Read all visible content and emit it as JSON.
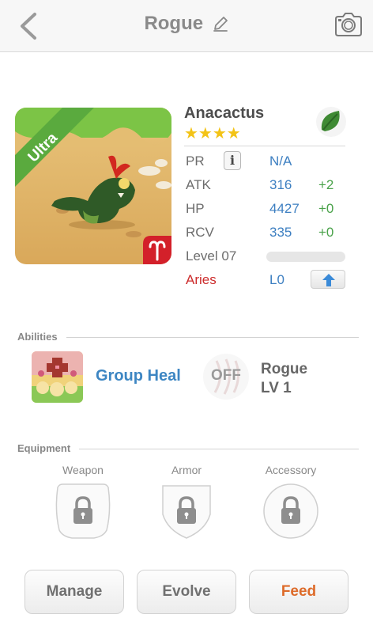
{
  "header": {
    "title": "Rogue",
    "icons": {
      "back": "chevron-left-icon",
      "edit": "pencil-icon",
      "camera": "camera-icon"
    }
  },
  "monster": {
    "rarity_ribbon": "Ultra",
    "name": "Anacactus",
    "star_count": 4,
    "stars": "★★★★",
    "element_icon": "leaf-icon",
    "zodiac_icon": "aries-icon",
    "stats": {
      "pr": {
        "label": "PR",
        "value": "N/A"
      },
      "atk": {
        "label": "ATK",
        "value": "316",
        "bonus": "+2"
      },
      "hp": {
        "label": "HP",
        "value": "4427",
        "bonus": "+0"
      },
      "rcv": {
        "label": "RCV",
        "value": "335",
        "bonus": "+0"
      },
      "level": {
        "label": "Level 07",
        "xp_fraction": 0.0
      },
      "sign": {
        "label": "Aries",
        "value": "L0"
      }
    },
    "colors": {
      "accent_blue": "#3d7fc1",
      "bonus_green": "#4aa24a",
      "aries_red": "#cc2c2c",
      "star_yellow": "#f3c316"
    }
  },
  "abilities": {
    "section_label": "Abilities",
    "primary": {
      "name": "Group Heal"
    },
    "role": {
      "status": "OFF",
      "name": "Rogue",
      "level": "LV 1"
    }
  },
  "equipment": {
    "section_label": "Equipment",
    "slots": [
      {
        "label": "Weapon",
        "state": "locked"
      },
      {
        "label": "Armor",
        "state": "locked"
      },
      {
        "label": "Accessory",
        "state": "locked"
      }
    ]
  },
  "actions": {
    "manage": "Manage",
    "evolve": "Evolve",
    "feed": "Feed"
  }
}
